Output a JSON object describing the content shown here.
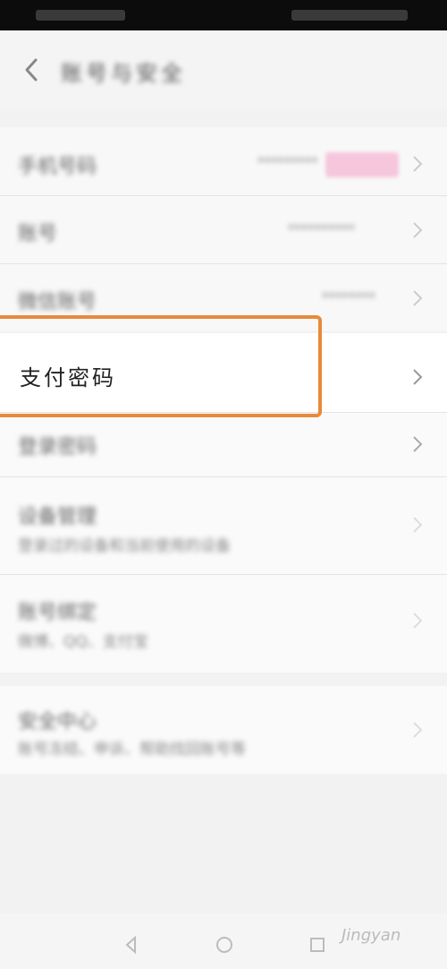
{
  "header": {
    "title": "账号与安全"
  },
  "rows": {
    "phone": {
      "label": "手机号码",
      "value": "*********"
    },
    "account": {
      "label": "账号",
      "value": "**********"
    },
    "wechat": {
      "label": "微信账号",
      "value": "********"
    },
    "pay_password": {
      "label": "支付密码"
    },
    "login_password": {
      "label": "登录密码"
    },
    "device": {
      "label": "设备管理",
      "desc": "登录过的设备和当前使用的设备"
    },
    "bind": {
      "label": "账号绑定",
      "desc": "微博、QQ、支付宝"
    },
    "security": {
      "label": "安全中心",
      "desc": "账号冻结、申诉、帮助找回账号等"
    }
  },
  "watermark": "Jingyan",
  "colors": {
    "highlight": "#e88a3a",
    "badge": "#f6c6dc"
  },
  "icons": [
    "back-icon",
    "chevron-right-icon",
    "nav-back-icon",
    "nav-home-icon",
    "nav-recent-icon"
  ]
}
